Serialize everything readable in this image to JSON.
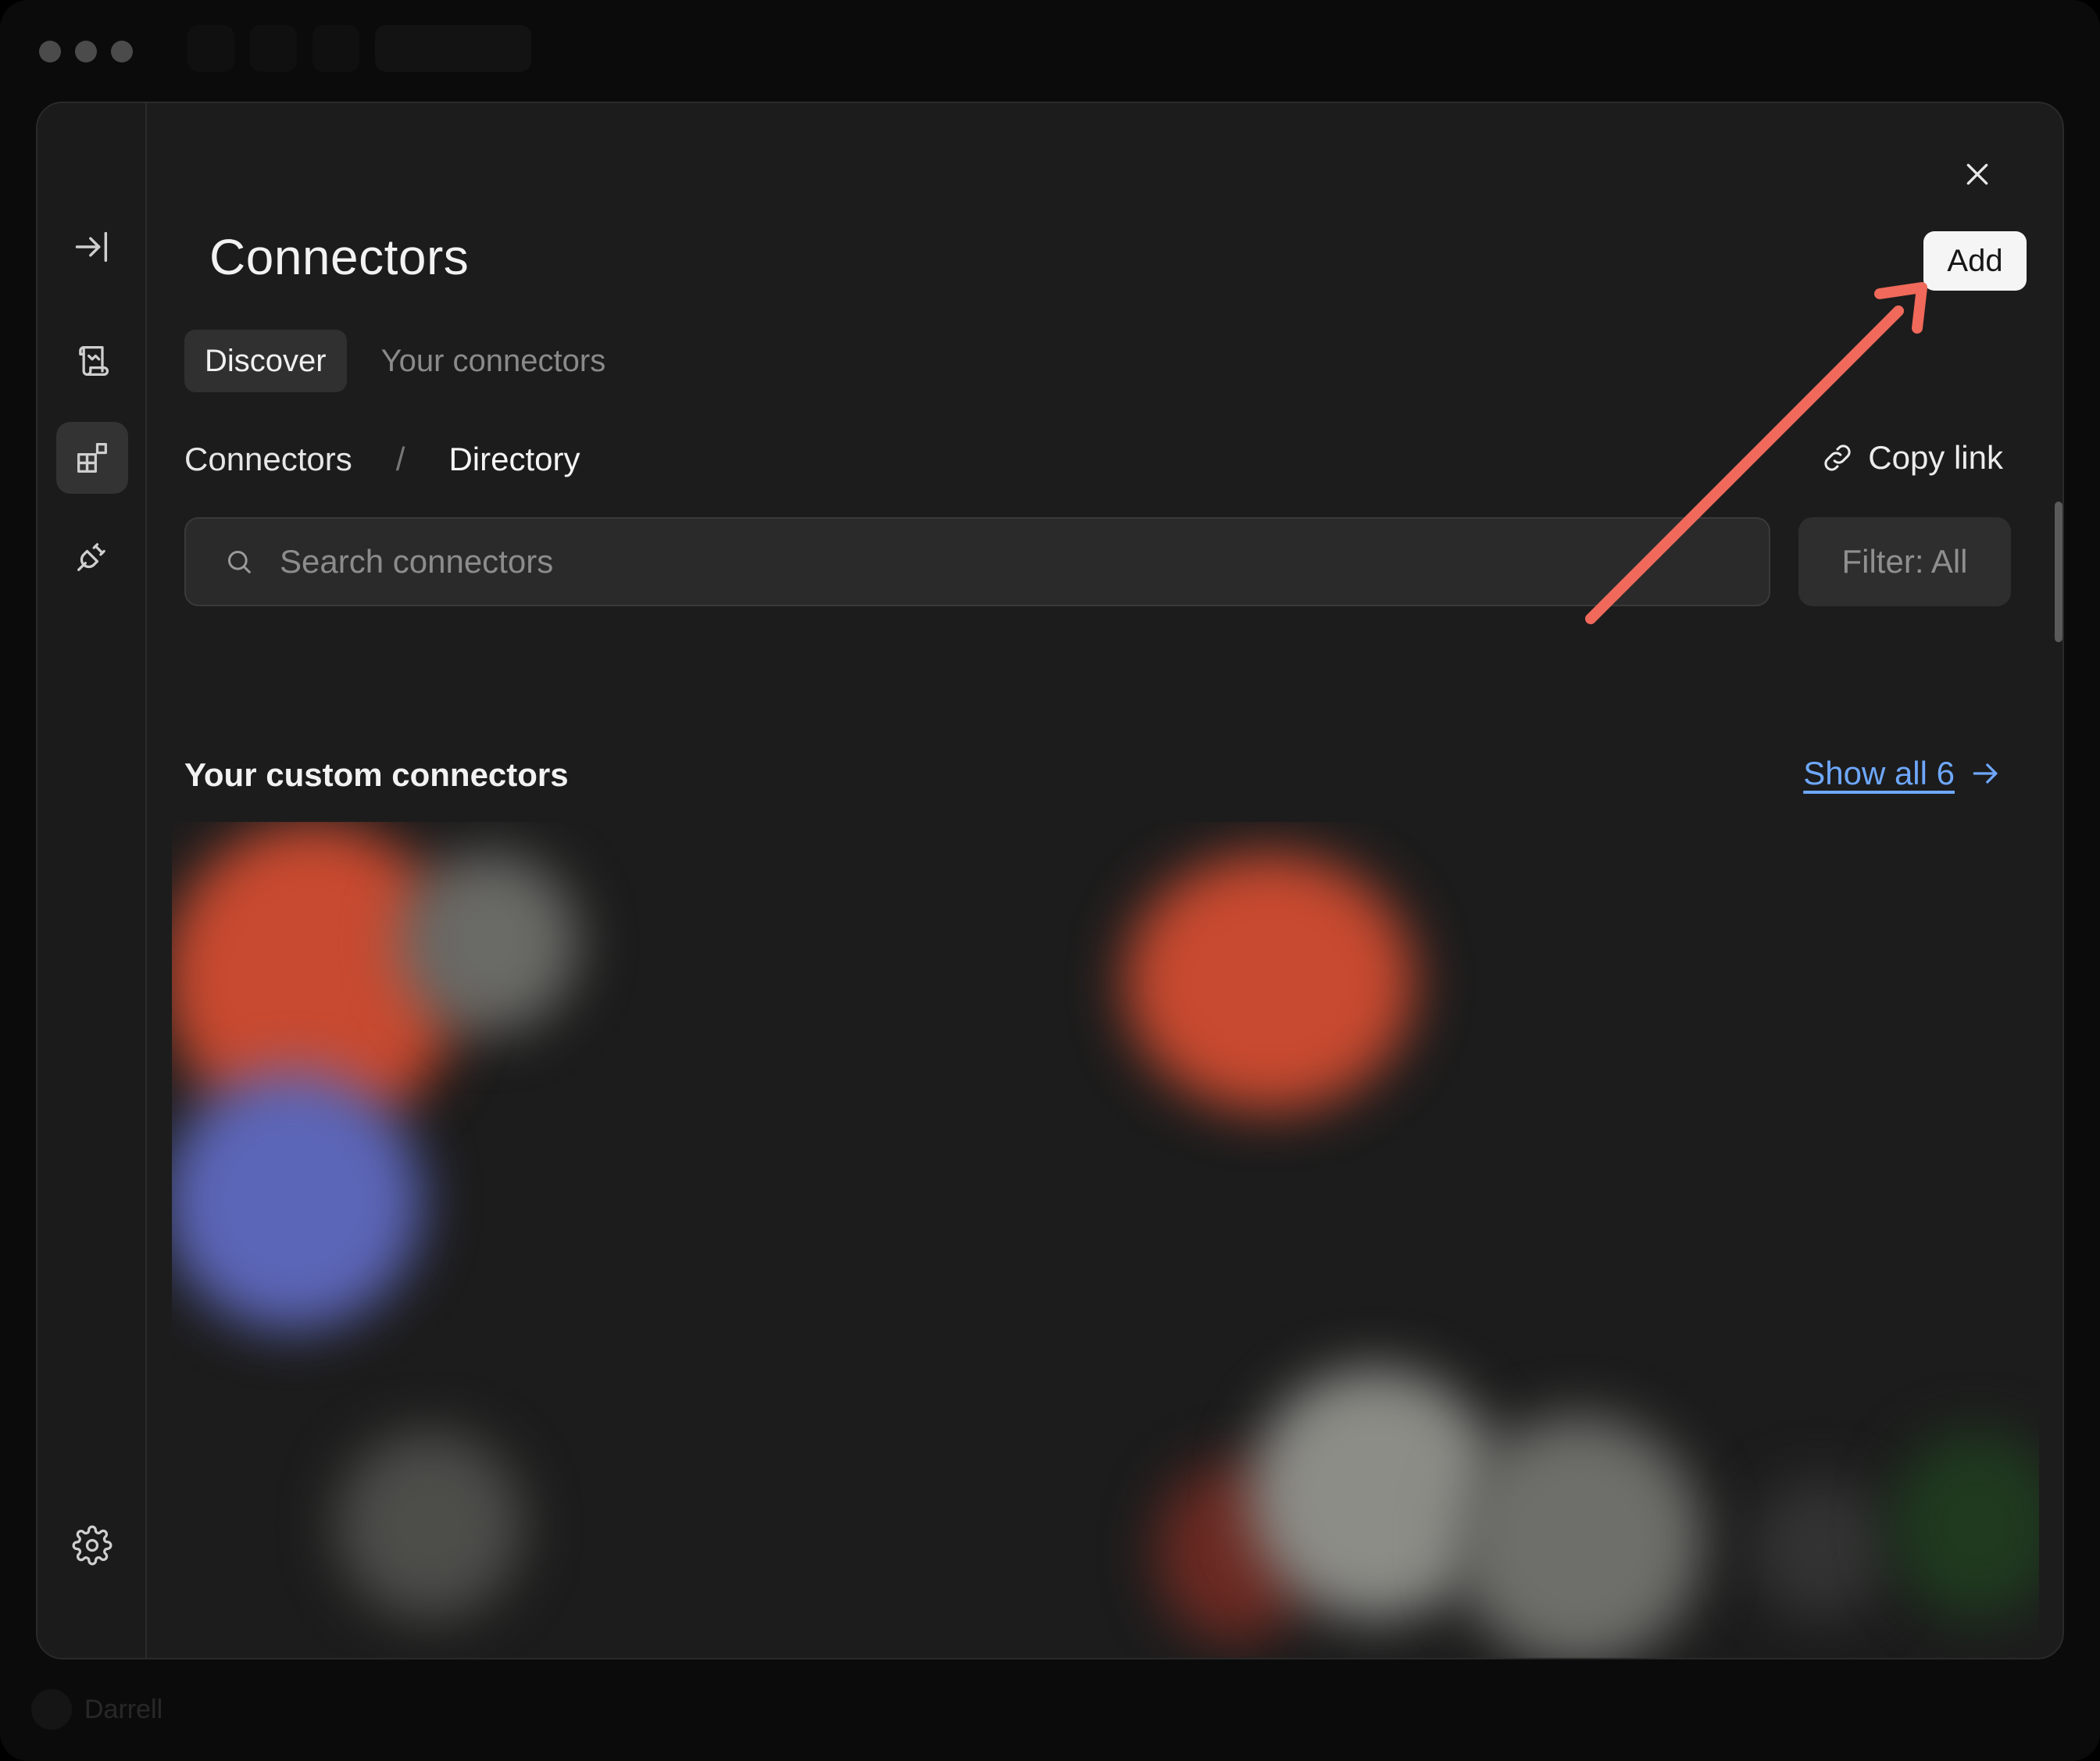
{
  "window": {
    "footer_user": "Darrell"
  },
  "modal": {
    "title": "Connectors",
    "add_label": "Add",
    "tabs": [
      {
        "label": "Discover",
        "active": true
      },
      {
        "label": "Your connectors",
        "active": false
      }
    ],
    "breadcrumb": {
      "root": "Connectors",
      "separator": "/",
      "current": "Directory"
    },
    "copy_link_label": "Copy link",
    "search": {
      "placeholder": "Search connectors",
      "value": ""
    },
    "filter_label": "Filter: All",
    "section": {
      "title": "Your custom connectors",
      "show_all_label": "Show all 6"
    }
  },
  "sidebar": {
    "items": [
      {
        "icon": "collapse-sidebar-icon"
      },
      {
        "icon": "scroll-icon"
      },
      {
        "icon": "connectors-grid-icon",
        "active": true
      },
      {
        "icon": "plug-icon"
      },
      {
        "icon": "gear-icon"
      }
    ]
  },
  "colors": {
    "modal_bg": "#1c1c1c",
    "link": "#6ea8ff",
    "annotation_arrow": "#f0695a"
  }
}
